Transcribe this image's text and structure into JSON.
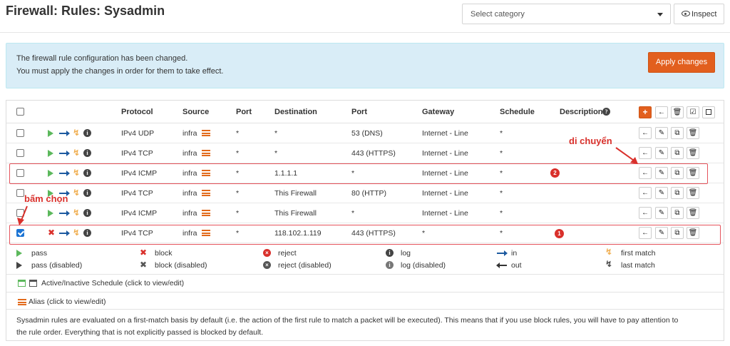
{
  "header": {
    "title": "Firewall: Rules: Sysadmin",
    "category_placeholder": "Select category",
    "inspect_label": "Inspect"
  },
  "alert": {
    "line1": "The firewall rule configuration has been changed.",
    "line2": "You must apply the changes in order for them to take effect.",
    "apply_label": "Apply changes"
  },
  "table": {
    "columns": [
      "Protocol",
      "Source",
      "Port",
      "Destination",
      "Port",
      "Gateway",
      "Schedule",
      "Description"
    ],
    "rows": [
      {
        "status": "pass",
        "protocol": "IPv4 UDP",
        "source": "infra",
        "src_port": "*",
        "destination": "*",
        "dst_port": "53 (DNS)",
        "gateway": "Internet - Line",
        "schedule": "*",
        "checked": false
      },
      {
        "status": "pass",
        "protocol": "IPv4 TCP",
        "source": "infra",
        "src_port": "*",
        "destination": "*",
        "dst_port": "443 (HTTPS)",
        "gateway": "Internet - Line",
        "schedule": "*",
        "checked": false
      },
      {
        "status": "pass",
        "protocol": "IPv4 ICMP",
        "source": "infra",
        "src_port": "*",
        "destination": "1.1.1.1",
        "dst_port": "*",
        "gateway": "Internet - Line",
        "schedule": "*",
        "checked": false
      },
      {
        "status": "pass",
        "protocol": "IPv4 TCP",
        "source": "infra",
        "src_port": "*",
        "destination": "This Firewall",
        "dst_port": "80 (HTTP)",
        "gateway": "Internet - Line",
        "schedule": "*",
        "checked": false
      },
      {
        "status": "pass",
        "protocol": "IPv4 ICMP",
        "source": "infra",
        "src_port": "*",
        "destination": "This Firewall",
        "dst_port": "*",
        "gateway": "Internet - Line",
        "schedule": "*",
        "checked": false
      },
      {
        "status": "block",
        "protocol": "IPv4 TCP",
        "source": "infra",
        "src_port": "*",
        "destination": "118.102.1.119",
        "dst_port": "443 (HTTPS)",
        "gateway": "*",
        "schedule": "*",
        "checked": true
      }
    ]
  },
  "annotations": {
    "move_label": "di chuyển",
    "select_label": "bấm chọn",
    "badge1": "1",
    "badge2": "2"
  },
  "legend": {
    "pass": "pass",
    "pass_disabled": "pass (disabled)",
    "block": "block",
    "block_disabled": "block (disabled)",
    "reject": "reject",
    "reject_disabled": "reject (disabled)",
    "log": "log",
    "log_disabled": "log (disabled)",
    "in": "in",
    "out": "out",
    "first_match": "first match",
    "last_match": "last match"
  },
  "footer": {
    "schedule_note": "Active/Inactive Schedule (click to view/edit)",
    "alias_note": "Alias (click to view/edit)",
    "description_line1": "Sysadmin rules are evaluated on a first-match basis by default (i.e. the action of the first rule to match a packet will be executed). This means that if you use block rules, you will have to pay attention to",
    "description_line2": "the rule order. Everything that is not explicitly passed is blocked by default."
  },
  "colors": {
    "accent": "#e25f1e",
    "alert_bg": "#d9edf7",
    "pass": "#5cb85c",
    "block": "#d9302b",
    "annotation": "#d9302b"
  }
}
